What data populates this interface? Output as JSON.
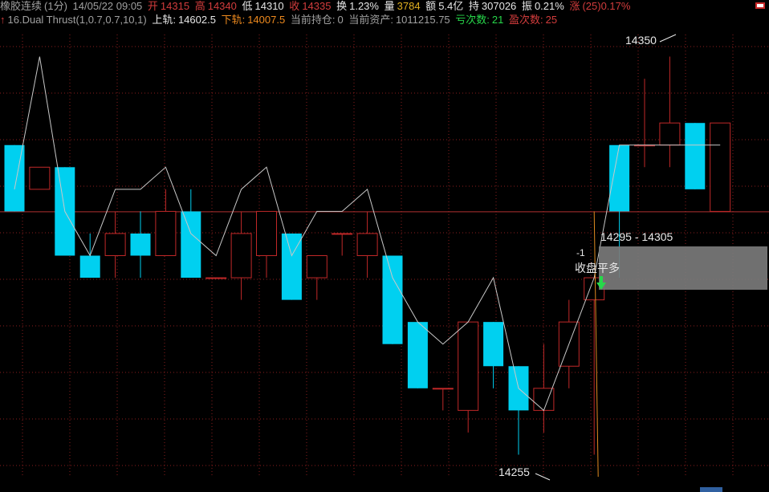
{
  "header": {
    "symbol": "橡胶连续",
    "interval": "(1分)",
    "datetime": "14/05/22 09:05",
    "open_label": "开",
    "open": "14315",
    "high_label": "高",
    "high": "14340",
    "low_label": "低",
    "low": "14310",
    "close_label": "收",
    "close": "14335",
    "turnover_label": "换",
    "turnover": "1.23%",
    "volume_label": "量",
    "volume": "3784",
    "amount_label": "额",
    "amount": "5.4亿",
    "oi_label": "持",
    "oi": "307026",
    "amp_label": "振",
    "amp": "0.21%",
    "change_label": "涨",
    "change": "(25)0.17%"
  },
  "indicator": {
    "arrow": "↑",
    "name": "16.Dual Thrust(1,0.7,0.7,10,1)",
    "upper_label": "上轨:",
    "upper": "14602.5",
    "lower_label": "下轨:",
    "lower": "14007.5",
    "position_label": "当前持仓:",
    "position": "0",
    "assets_label": "当前资产:",
    "assets": "1011215.75",
    "loss_label": "亏次数:",
    "loss": "21",
    "win_label": "盈次数:",
    "win": "25"
  },
  "annotations": {
    "peak_label": "14350",
    "trough_label": "14255",
    "range_label": "14295 - 14305",
    "signal_value": "-1",
    "signal_text": "收盘平多"
  },
  "colors": {
    "up": "#c02828",
    "down": "#00d0f0",
    "line": "#c8c8c8",
    "grid": "#8a1e1e",
    "hline": "#b03030"
  },
  "chart_data": {
    "type": "candlestick",
    "ylim": [
      14255,
      14355
    ],
    "ref_level": 14315,
    "candles": [
      {
        "o": 14330,
        "h": 14330,
        "l": 14315,
        "c": 14315
      },
      {
        "o": 14320,
        "h": 14325,
        "l": 14320,
        "c": 14325
      },
      {
        "o": 14325,
        "h": 14325,
        "l": 14305,
        "c": 14305
      },
      {
        "o": 14305,
        "h": 14310,
        "l": 14300,
        "c": 14300
      },
      {
        "o": 14305,
        "h": 14315,
        "l": 14300,
        "c": 14310
      },
      {
        "o": 14310,
        "h": 14315,
        "l": 14300,
        "c": 14305
      },
      {
        "o": 14305,
        "h": 14320,
        "l": 14305,
        "c": 14315
      },
      {
        "o": 14315,
        "h": 14320,
        "l": 14300,
        "c": 14300
      },
      {
        "o": 14300,
        "h": 14300,
        "l": 14300,
        "c": 14300
      },
      {
        "o": 14300,
        "h": 14315,
        "l": 14295,
        "c": 14310
      },
      {
        "o": 14305,
        "h": 14310,
        "l": 14300,
        "c": 14315
      },
      {
        "o": 14310,
        "h": 14310,
        "l": 14295,
        "c": 14295
      },
      {
        "o": 14300,
        "h": 14305,
        "l": 14295,
        "c": 14305
      },
      {
        "o": 14310,
        "h": 14310,
        "l": 14305,
        "c": 14310
      },
      {
        "o": 14305,
        "h": 14315,
        "l": 14300,
        "c": 14310
      },
      {
        "o": 14305,
        "h": 14305,
        "l": 14285,
        "c": 14285
      },
      {
        "o": 14290,
        "h": 14290,
        "l": 14275,
        "c": 14275
      },
      {
        "o": 14275,
        "h": 14275,
        "l": 14270,
        "c": 14275
      },
      {
        "o": 14270,
        "h": 14290,
        "l": 14265,
        "c": 14290
      },
      {
        "o": 14290,
        "h": 14290,
        "l": 14275,
        "c": 14280
      },
      {
        "o": 14280,
        "h": 14280,
        "l": 14260,
        "c": 14270
      },
      {
        "o": 14270,
        "h": 14285,
        "l": 14265,
        "c": 14275
      },
      {
        "o": 14280,
        "h": 14295,
        "l": 14275,
        "c": 14290
      },
      {
        "o": 14295,
        "h": 14300,
        "l": 14260,
        "c": 14300
      },
      {
        "o": 14330,
        "h": 14330,
        "l": 14300,
        "c": 14315
      },
      {
        "o": 14330,
        "h": 14345,
        "l": 14325,
        "c": 14330
      },
      {
        "o": 14330,
        "h": 14350,
        "l": 14325,
        "c": 14335
      },
      {
        "o": 14335,
        "h": 14335,
        "l": 14320,
        "c": 14320
      },
      {
        "o": 14315,
        "h": 14335,
        "l": 14315,
        "c": 14335
      }
    ],
    "line": [
      14320,
      14350,
      14315,
      14305,
      14320,
      14320,
      14325,
      14310,
      14305,
      14320,
      14325,
      14305,
      14315,
      14315,
      14320,
      14300,
      14290,
      14285,
      14290,
      14300,
      14275,
      14270,
      14285,
      14300,
      14330,
      14330,
      14330,
      14330,
      14330
    ]
  }
}
